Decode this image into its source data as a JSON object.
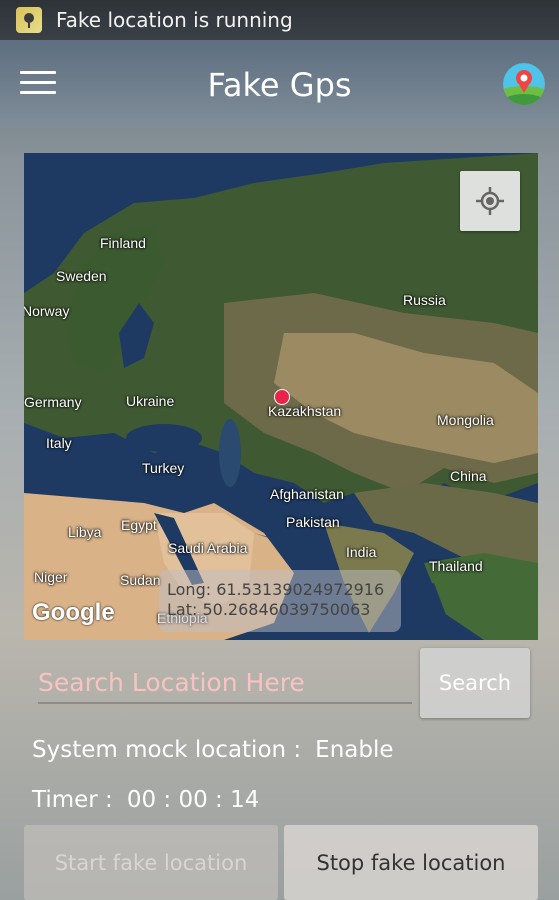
{
  "status_bar": {
    "text": "Fake location is running",
    "icon": "app-notification-icon"
  },
  "app_bar": {
    "title": "Fake Gps",
    "menu_icon": "hamburger-menu-icon",
    "app_icon": "map-pin-globe-icon"
  },
  "map": {
    "labels": {
      "finland": "Finland",
      "sweden": "Sweden",
      "norway": "Norway",
      "russia": "Russia",
      "germany": "Germany",
      "ukraine": "Ukraine",
      "kazakhstan": "Kazakhstan",
      "mongolia": "Mongolia",
      "italy": "Italy",
      "turkey": "Turkey",
      "china": "China",
      "afghanistan": "Afghanistan",
      "pakistan": "Pakistan",
      "libya": "Libya",
      "egypt": "Egypt",
      "saudi_arabia": "Saudi Arabia",
      "india": "India",
      "thailand": "Thailand",
      "niger": "Niger",
      "sudan": "Sudan",
      "ethiopia": "Ethiopia"
    },
    "google_logo": "Google",
    "longitude": "Long: 61.53139024972916",
    "latitude": "Lat: 50.26846039750063",
    "my_location_icon": "crosshair-location-icon"
  },
  "search": {
    "placeholder": "Search Location Here",
    "button": "Search"
  },
  "mock": {
    "label": "System mock location :",
    "value": "Enable"
  },
  "timer": {
    "label": "Timer :",
    "value": "00 : 00 : 14"
  },
  "buttons": {
    "start": "Start fake location",
    "stop": "Stop fake location"
  },
  "colors": {
    "pin": "#e8244a",
    "placeholder": "#f7c3c3"
  }
}
